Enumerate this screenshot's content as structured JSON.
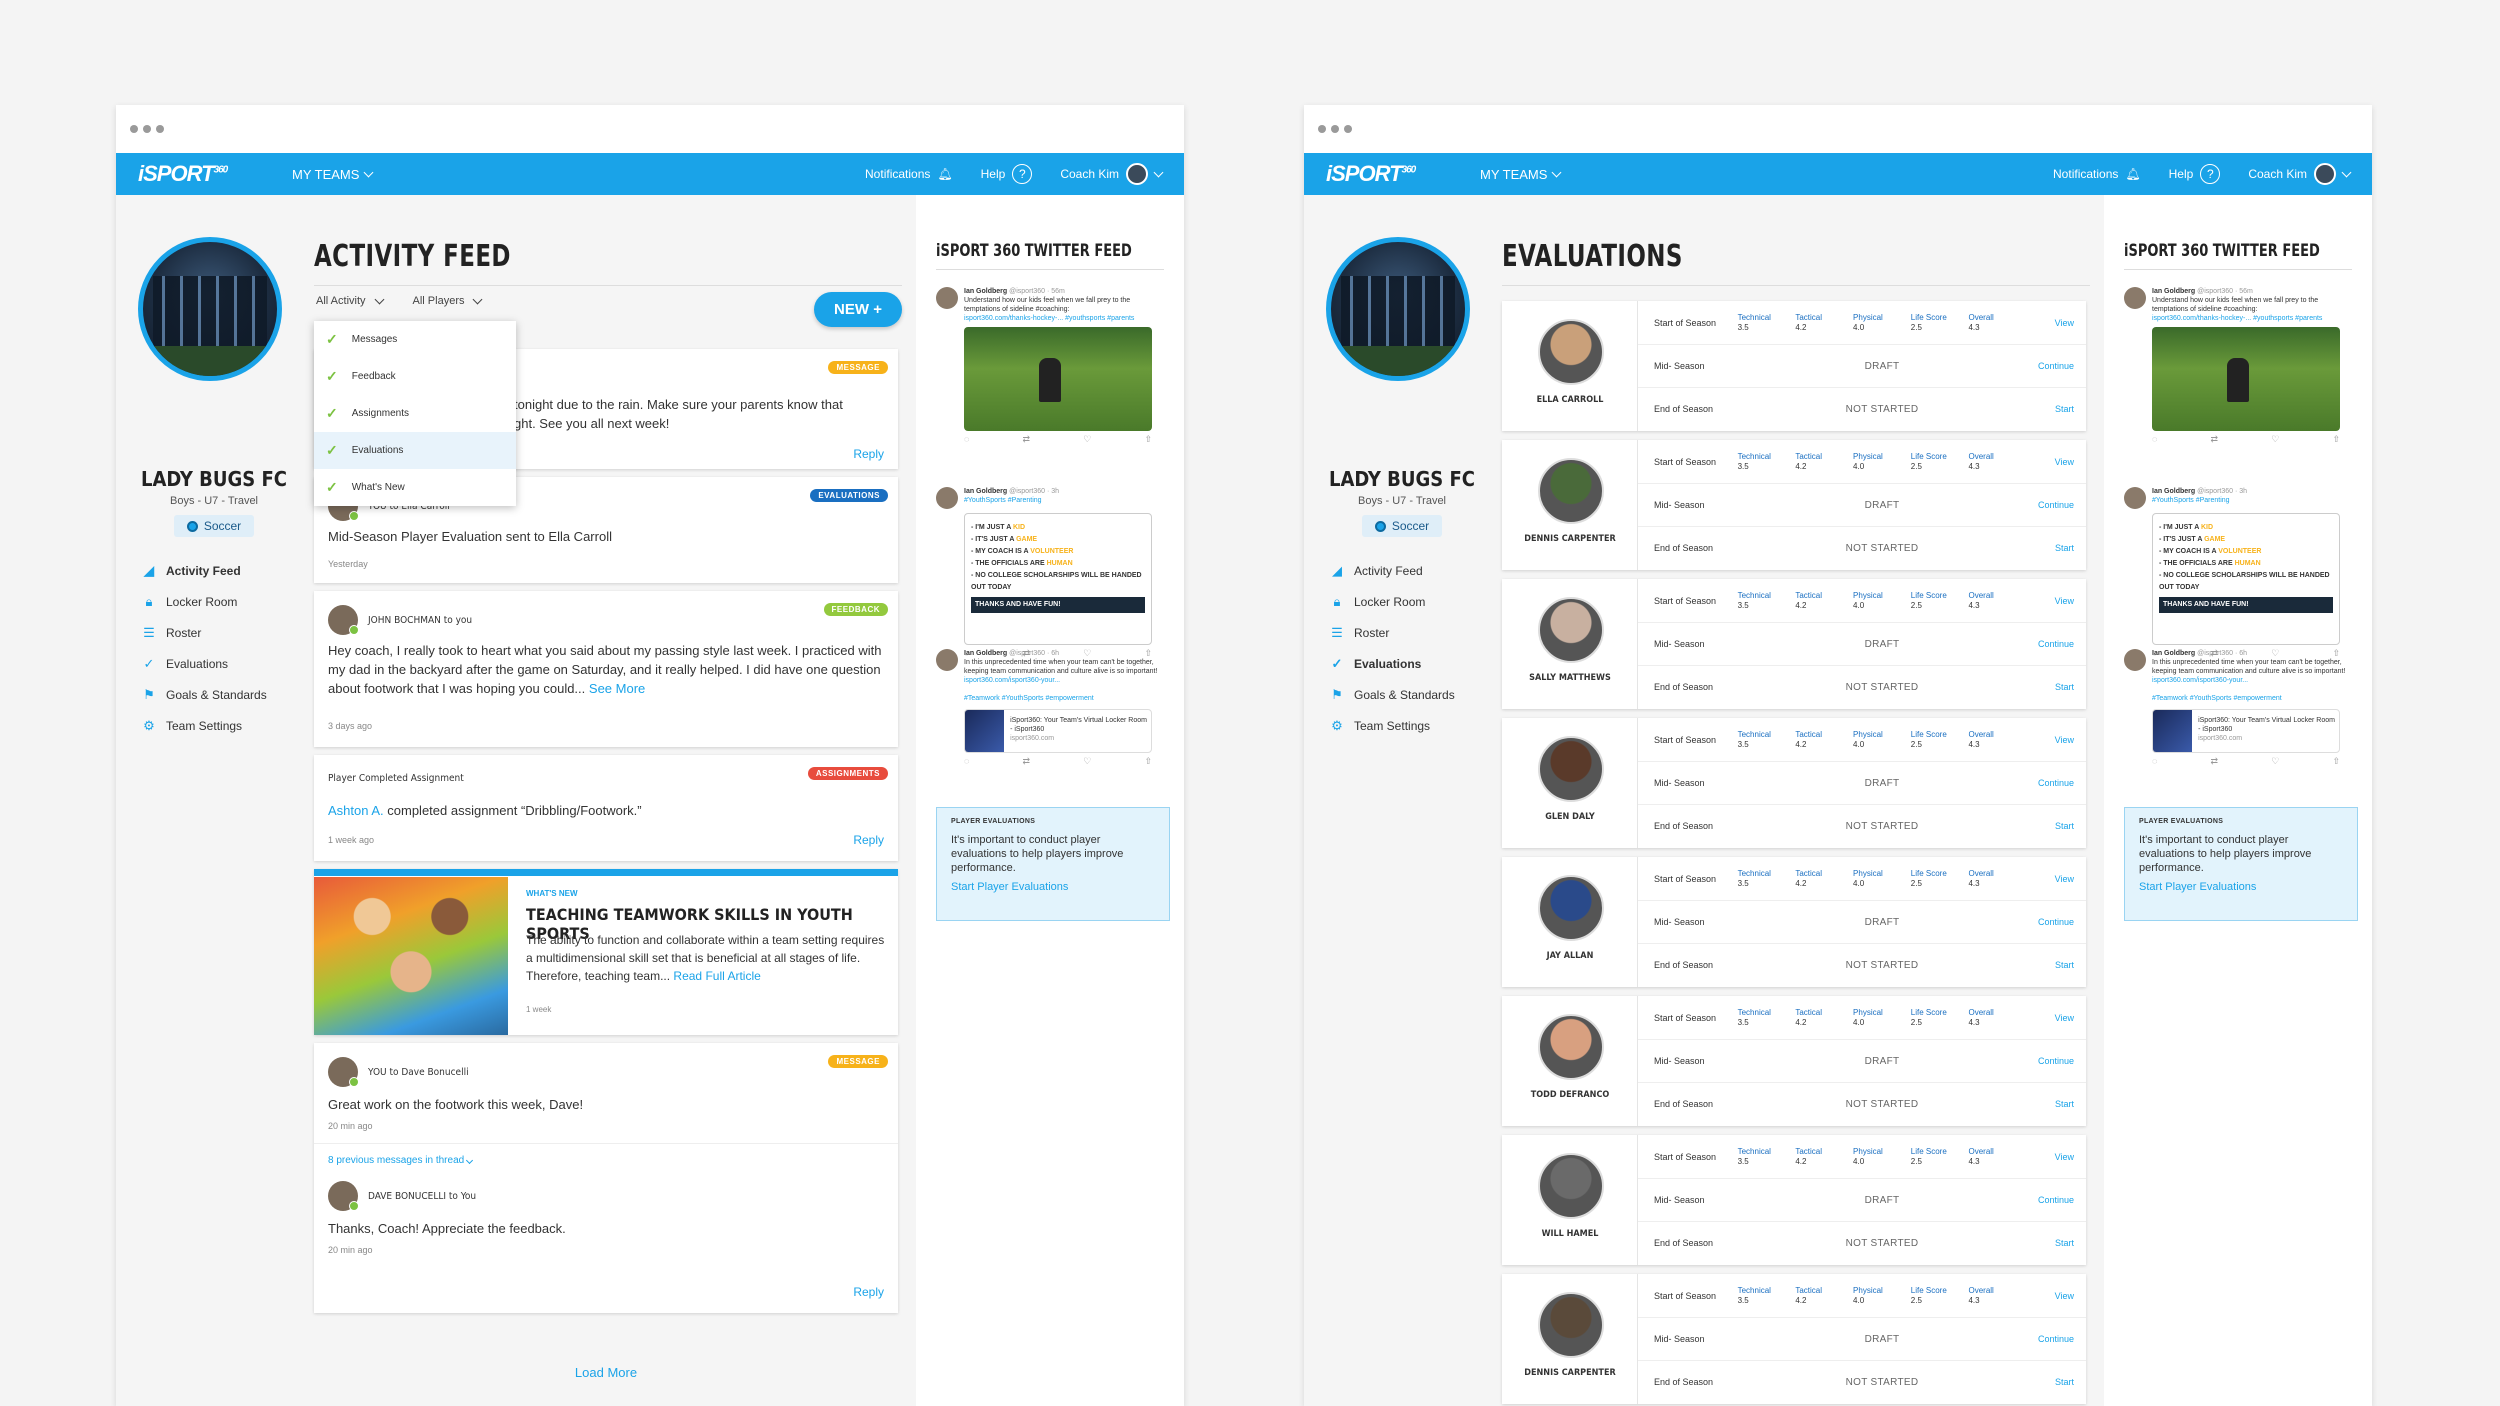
{
  "brand": {
    "logo": "iSPORT",
    "logo_sup": "360",
    "accent": "#1aa3e8"
  },
  "nav": {
    "my_teams": "MY TEAMS",
    "notifications": "Notifications",
    "help": "Help",
    "user": "Coach Kim"
  },
  "team": {
    "name": "LADY BUGS FC",
    "sub": "Boys - U7 - Travel",
    "sport": "Soccer"
  },
  "sidebar_items": [
    "Activity Feed",
    "Locker Room",
    "Roster",
    "Evaluations",
    "Goals & Standards",
    "Team Settings"
  ],
  "feed": {
    "title": "ACTIVITY FEED",
    "filter_activity": "All Activity",
    "filter_players": "All Players",
    "new_button": "NEW +",
    "dropdown": [
      "Messages",
      "Feedback",
      "Assignments",
      "Evaluations",
      "What's New"
    ],
    "card1": {
      "tag": "MESSAGE",
      "text": "tonight due to the rain. Make sure your parents know that",
      "text2": "ght. See you all next week!",
      "reply": "Reply"
    },
    "card2": {
      "tag": "EVALUATIONS",
      "who": "YOU to Ella Carroll",
      "text": "Mid-Season Player Evaluation sent to Ella Carroll",
      "meta": "Yesterday"
    },
    "card3": {
      "tag": "FEEDBACK",
      "who": "JOHN BOCHMAN to you",
      "text": "Hey coach, I really took to heart what you said about my passing style last week. I practiced with my dad in the backyard after the game on Saturday, and it really helped. I did have one question about footwork that I was hoping you could...",
      "more": "See More",
      "meta": "3 days ago"
    },
    "card4": {
      "tag": "ASSIGNMENTS",
      "who": "Player Completed Assignment",
      "name": "Ashton A.",
      "text": " completed assignment “Dribbling/Footwork.”",
      "meta": "1 week ago",
      "reply": "Reply"
    },
    "card5": {
      "label": "WHAT'S NEW",
      "title": "TEACHING TEAMWORK SKILLS IN YOUTH SPORTS",
      "text": "The ability to function and collaborate within a team setting requires a multidimensional skill set that is beneficial at all stages of life. Therefore, teaching team...",
      "more": "Read Full Article",
      "meta": "1 week"
    },
    "card6": {
      "tag": "MESSAGE",
      "who": "YOU to Dave Bonucelli",
      "text": "Great work on the footwork this week, Dave!",
      "meta": "20 min ago",
      "thread": "8 previous messages in thread",
      "who2": "DAVE BONUCELLI to You",
      "text2": "Thanks, Coach! Appreciate the feedback.",
      "meta2": "20 min ago",
      "reply": "Reply"
    },
    "load_more": "Load More"
  },
  "twitter": {
    "title": "iSPORT 360 TWITTER FEED",
    "tweets": [
      {
        "name": "Ian Goldberg",
        "handle": "@isport360 · 56m",
        "text": "Understand how our kids feel when we fall prey to the temptations of sideline #coaching:",
        "link": "isport360.com/thanks-hockey-... #youthsports #parents"
      },
      {
        "name": "Ian Goldberg",
        "handle": "@isport360 · 3h",
        "text": "#YouthSports #Parenting",
        "poster": [
          "- I'M JUST A ",
          "KID",
          "- IT'S JUST A ",
          "GAME",
          "- MY COACH IS A ",
          "VOLUNTEER",
          "- THE OFFICIALS ARE ",
          "HUMAN",
          "- NO COLLEGE SCHOLARSHIPS WILL BE HANDED OUT TODAY",
          "THANKS AND HAVE FUN!"
        ]
      },
      {
        "name": "Ian Goldberg",
        "handle": "@isport360 · 6h",
        "text": "In this unprecedented time when your team can't be together, keeping team communication and culture alive is so important!",
        "link": "isport360.com/isport360-your...",
        "tags": "#Teamwork #YouthSports #empowerment",
        "card_title": "iSport360: Your Team's Virtual Locker Room - iSport360",
        "card_url": "isport360.com"
      }
    ],
    "info": {
      "heading": "PLAYER EVALUATIONS",
      "text": "It's important to conduct player evaluations to help players improve performance.",
      "link": "Start Player Evaluations"
    }
  },
  "evaluations": {
    "title": "EVALUATIONS",
    "row_labels": [
      "Start of Season",
      "Mid- Season",
      "End of Season"
    ],
    "score_keys": [
      "Technical",
      "Tactical",
      "Physical",
      "Life Score",
      "Overall"
    ],
    "score_values": [
      "3.5",
      "4.2",
      "4.0",
      "2.5",
      "4.3"
    ],
    "status_draft": "DRAFT",
    "status_not_started": "NOT STARTED",
    "actions": [
      "View",
      "Continue",
      "Start"
    ],
    "players": [
      "ELLA CARROLL",
      "DENNIS CARPENTER",
      "SALLY MATTHEWS",
      "GLEN DALY",
      "JAY ALLAN",
      "TODD DEFRANCO",
      "WILL HAMEL",
      "DENNIS CARPENTER"
    ]
  }
}
